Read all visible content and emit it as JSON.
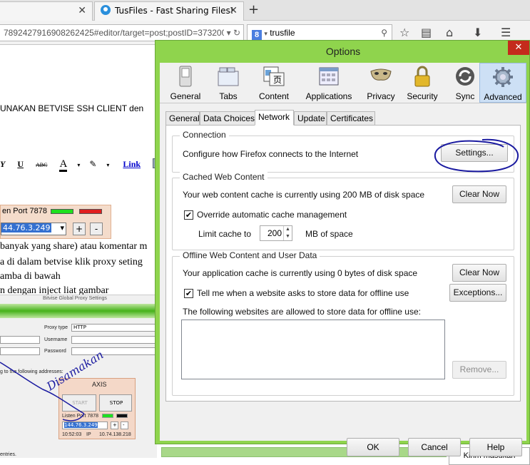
{
  "browser": {
    "tabs": [
      {
        "label": ""
      },
      {
        "label": "TusFiles - Fast Sharing Files!"
      }
    ],
    "url": "7892427916908262425#editor/target=post;postID=373200",
    "search_engine_letter": "8",
    "search_value": "trusfile"
  },
  "page": {
    "heading": "UNAKAN BETVISE SSH CLIENT den",
    "editor_tools": [
      "Y",
      "U",
      "ABC",
      "A",
      "Link"
    ],
    "axis_port_label": "en Port 7878",
    "axis_ip": "44.76.3.249",
    "body_lines": [
      "banyak yang share) atau komentar m",
      "a di dalam betvise klik proxy seting",
      "amba di bawah",
      "n dengan inject liat gambar"
    ],
    "proxy_title": "Bitvise Global Proxy Settings",
    "proxy_type_label": "Proxy type",
    "proxy_type_value": "HTTP",
    "username_label": "Username",
    "password_label": "Password",
    "addresses_text": "g to the following addresses:",
    "entries_text": "entries.",
    "axis_title": "AXIS",
    "start_label": "START",
    "stop_label": "STOP",
    "listen_port": "Listen Port 7878",
    "axis2_ip": "144.76.3.249",
    "time": "10:52:03",
    "ip_label": "IP",
    "ip_value": "10.74.138.218",
    "handwriting": "Disamakan",
    "feedback": "Kirim masukan"
  },
  "dialog": {
    "title": "Options",
    "panes": [
      "General",
      "Tabs",
      "Content",
      "Applications",
      "Privacy",
      "Security",
      "Sync",
      "Advanced"
    ],
    "selected_pane": "Advanced",
    "subtabs": [
      "General",
      "Data Choices",
      "Network",
      "Update",
      "Certificates"
    ],
    "selected_subtab": "Network",
    "connection": {
      "title": "Connection",
      "text": "Configure how Firefox connects to the Internet",
      "settings_button": "Settings..."
    },
    "cache": {
      "title": "Cached Web Content",
      "text": "Your web content cache is currently using 200 MB of disk space",
      "clear_button": "Clear Now",
      "override_label": "Override automatic cache management",
      "override_checked": true,
      "limit_label": "Limit cache to",
      "limit_value": "200",
      "limit_unit": "MB of space"
    },
    "offline": {
      "title": "Offline Web Content and User Data",
      "text": "Your application cache is currently using 0 bytes of disk space",
      "clear_button": "Clear Now",
      "tell_label": "Tell me when a website asks to store data for offline use",
      "tell_checked": true,
      "exceptions_button": "Exceptions...",
      "list_label": "The following websites are allowed to store data for offline use:",
      "remove_button": "Remove..."
    },
    "footer": {
      "ok": "OK",
      "cancel": "Cancel",
      "help": "Help"
    },
    "colors": {
      "frame": "#8fd44d",
      "close": "#c42b1c",
      "selected_pane": "#cde0f5",
      "annotation": "#1a1aa0"
    }
  }
}
